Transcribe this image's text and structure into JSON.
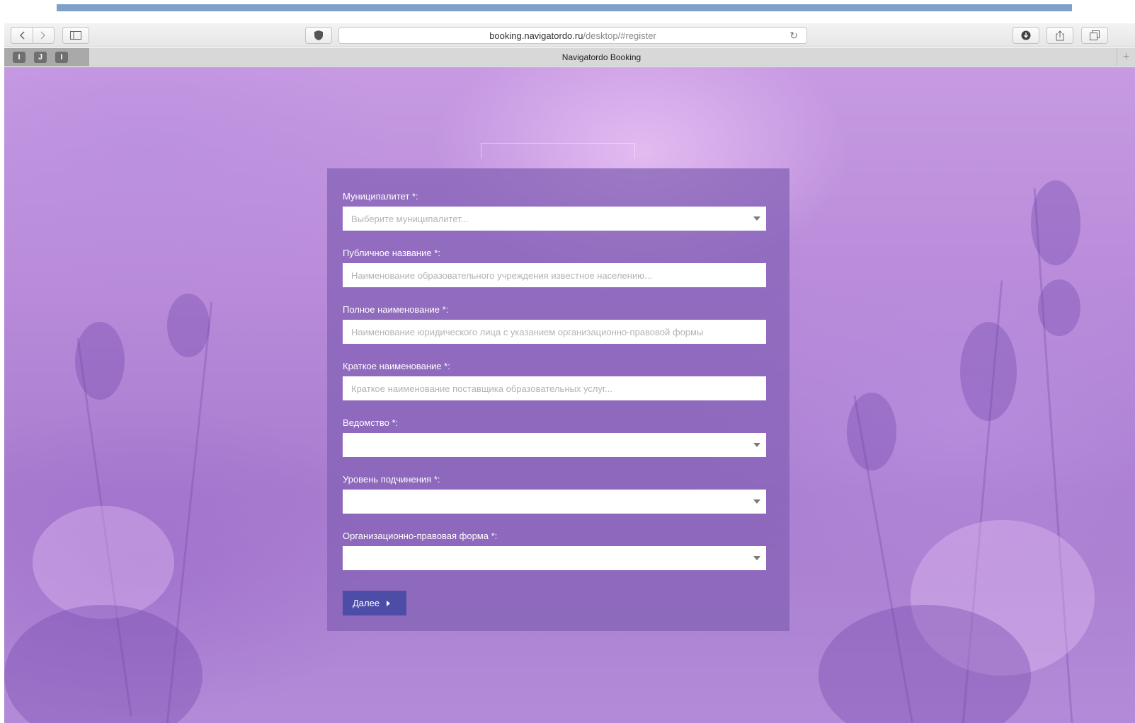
{
  "browser": {
    "url_domain": "booking.navigatordo.ru",
    "url_path": "/desktop/#register",
    "tab_title": "Navigatordo Booking",
    "tab_icons": [
      "I",
      "J",
      "I"
    ]
  },
  "form": {
    "fields": [
      {
        "label": "Муниципалитет",
        "required": "*:",
        "placeholder": "Выберите муниципалитет...",
        "type": "select"
      },
      {
        "label": "Публичное название",
        "required": "*:",
        "placeholder": "Наименование образовательного учреждения известное населению...",
        "type": "text"
      },
      {
        "label": "Полное наименование",
        "required": "*:",
        "placeholder": "Наименование юридического лица с указанием организационно-правовой формы",
        "type": "text"
      },
      {
        "label": "Краткое наименование",
        "required": "*:",
        "placeholder": "Краткое наименование поставщика образовательных услуг...",
        "type": "text"
      },
      {
        "label": "Ведомство",
        "required": "*:",
        "placeholder": "",
        "type": "select"
      },
      {
        "label": "Уровень подчинения",
        "required": "*:",
        "placeholder": "",
        "type": "select"
      },
      {
        "label": "Организационно-правовая форма",
        "required": "*:",
        "placeholder": "",
        "type": "select"
      }
    ],
    "next_label": "Далее"
  },
  "colors": {
    "panel": "#825fb4",
    "button": "#4d4da8",
    "accent_strip": "#7fa1c8"
  }
}
